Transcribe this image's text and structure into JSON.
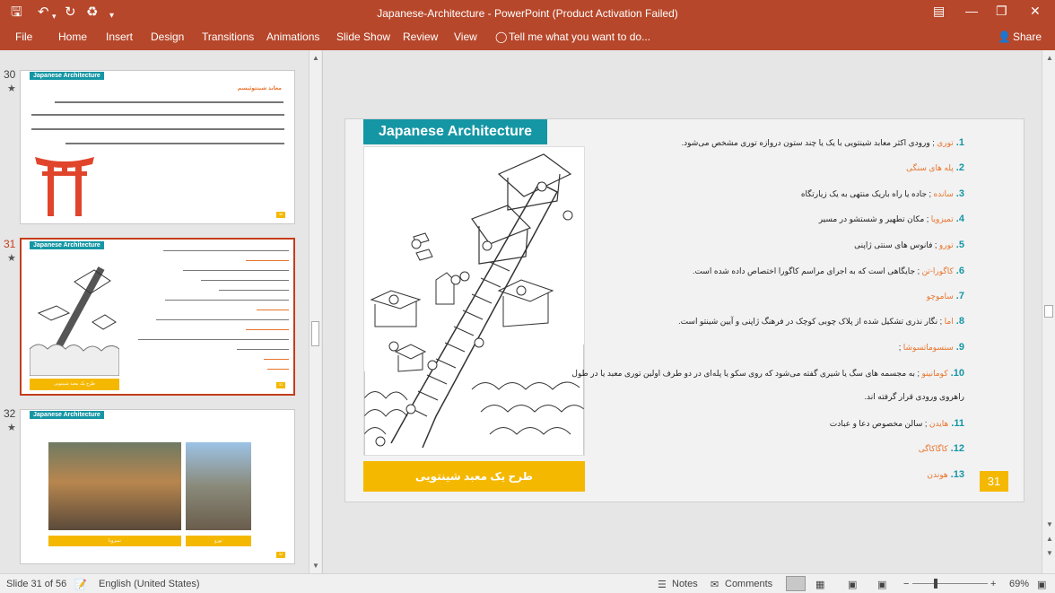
{
  "window": {
    "title": "Japanese-Architecture - PowerPoint (Product Activation Failed)",
    "save_icon": "save-icon",
    "undo_icon": "undo-icon",
    "redo_icon": "redo-icon",
    "present_icon": "present-icon"
  },
  "ribbon": {
    "tabs": [
      "File",
      "Home",
      "Insert",
      "Design",
      "Transitions",
      "Animations",
      "Slide Show",
      "Review",
      "View"
    ],
    "tell_me": "Tell me what you want to do...",
    "share": "Share"
  },
  "thumbnails": [
    {
      "number": "30",
      "badge": "Japanese Architecture",
      "heading": "معابد شینتوئیسم",
      "num_tag": "30"
    },
    {
      "number": "31",
      "badge": "Japanese Architecture",
      "caption": "طرح یک معبد شینتویی",
      "num_tag": "31"
    },
    {
      "number": "32",
      "badge": "Japanese Architecture",
      "caption_left": "تمیزویا",
      "caption_right": "تورو",
      "num_tag": "32"
    }
  ],
  "slide": {
    "badge": "Japanese Architecture",
    "caption": "طرح یک معبد شینتویی",
    "slide_number": "31",
    "items": [
      {
        "n": "1",
        "key": "توری",
        "text": " ; ورودی اکثر معابد شینتویی با یک یا چند ستون دروازه توری مشخص می‌شود."
      },
      {
        "n": "2",
        "key": "پله های سنگی",
        "text": ""
      },
      {
        "n": "3",
        "key": "سانده",
        "text": " ; جاده یا راه باریک منتهی به یک زیارتگاه"
      },
      {
        "n": "4",
        "key": "تمیزویا",
        "text": " ; مکان تطهیر و شستشو در مسیر"
      },
      {
        "n": "5",
        "key": "تورو",
        "text": " ; فانوس های سنتی ژاپنی"
      },
      {
        "n": "6",
        "key": "کاگورا-تن",
        "text": " ; جایگاهی است که به اجرای مراسم کاگورا اختصاص داده شده است."
      },
      {
        "n": "7",
        "key": "ساموچو",
        "text": ""
      },
      {
        "n": "8",
        "key": "اما",
        "text": " ; نگار نذری تشکیل شده از پلاک چوبی کوچک در فرهنگ ژاپنی و آیین شینتو است."
      },
      {
        "n": "9",
        "key": "سنسوماتسوشا",
        "text": " ;"
      },
      {
        "n": "10",
        "key": "کومانینو",
        "text": " ; به مجسمه های سگ یا شیری گفته می‌شود که روی سکو یا پله‌ای در دو طرف اولین توری معبد یا در طول"
      },
      {
        "n": "",
        "key": "",
        "text": "راهروی ورودی قرار گرفته اند."
      },
      {
        "n": "11",
        "key": "هایدن",
        "text": " ; سالن مخصوص دعا و عبادت"
      },
      {
        "n": "12",
        "key": "کاگاکاگی",
        "text": ""
      },
      {
        "n": "13",
        "key": "هوندن",
        "text": ""
      }
    ]
  },
  "status": {
    "slide_info": "Slide 31 of 56",
    "language": "English (United States)",
    "notes": "Notes",
    "comments": "Comments",
    "zoom": "69%"
  }
}
